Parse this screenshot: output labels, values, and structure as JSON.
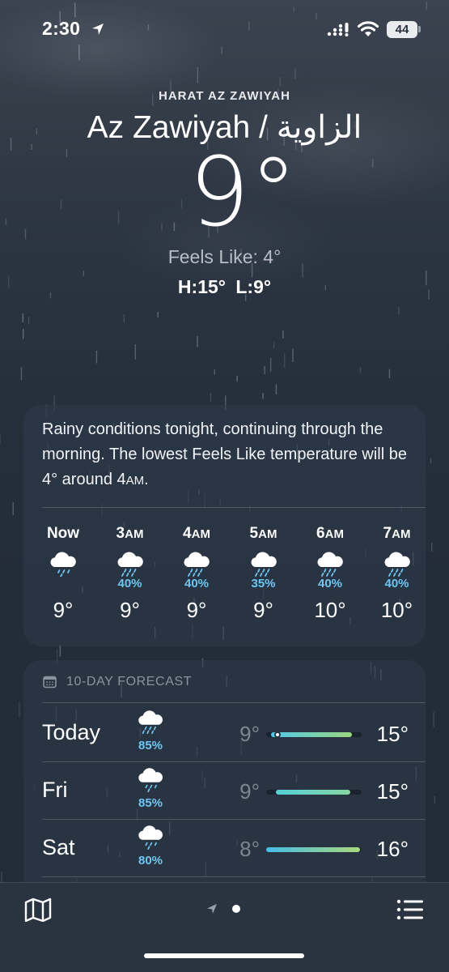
{
  "status_bar": {
    "time": "2:30",
    "battery": "44",
    "icons": [
      "location-arrow-icon",
      "cellular-signal-icon",
      "wifi-icon",
      "battery-icon"
    ]
  },
  "location": {
    "region": "HARAT AZ ZAWIYAH",
    "city": "Az Zawiyah / الزاوية",
    "temperature": "9°",
    "feels_like": "Feels Like: 4°",
    "high_low": "H:15°  L:9°"
  },
  "hourly_card": {
    "summary_part1": "Rainy conditions tonight, continuing through the morning. The lowest Feels Like temperature will be 4° around 4",
    "summary_part2": "AM",
    "summary_part3": ".",
    "hours": [
      {
        "label": "Now",
        "suffix": "",
        "icon": "cloud-drizzle-icon",
        "pct": "",
        "temp": "9°"
      },
      {
        "label": "3",
        "suffix": "AM",
        "icon": "cloud-rain-icon",
        "pct": "40%",
        "temp": "9°"
      },
      {
        "label": "4",
        "suffix": "AM",
        "icon": "cloud-rain-icon",
        "pct": "40%",
        "temp": "9°"
      },
      {
        "label": "5",
        "suffix": "AM",
        "icon": "cloud-rain-icon",
        "pct": "35%",
        "temp": "9°"
      },
      {
        "label": "6",
        "suffix": "AM",
        "icon": "cloud-rain-icon",
        "pct": "40%",
        "temp": "10°"
      },
      {
        "label": "7",
        "suffix": "AM",
        "icon": "cloud-rain-icon",
        "pct": "40%",
        "temp": "10°"
      }
    ]
  },
  "daily_card": {
    "header": "10-DAY FORECAST",
    "header_icon": "calendar-icon",
    "days": [
      {
        "name": "Today",
        "icon": "cloud-rain-icon",
        "pct": "85%",
        "low": "9°",
        "high": "15°",
        "bar_start": 0.05,
        "bar_end": 0.9,
        "bar_from": "#4fc9e8",
        "bar_to": "#9bd67f",
        "now_marker": 0.12
      },
      {
        "name": "Fri",
        "icon": "cloud-drizzle-icon",
        "pct": "85%",
        "low": "9°",
        "high": "15°",
        "bar_start": 0.1,
        "bar_end": 0.88,
        "bar_from": "#55d0d8",
        "bar_to": "#86d6a2"
      },
      {
        "name": "Sat",
        "icon": "cloud-drizzle-icon",
        "pct": "80%",
        "low": "8°",
        "high": "16°",
        "bar_start": 0.0,
        "bar_end": 0.98,
        "bar_from": "#45bde6",
        "bar_to": "#a8d87c"
      }
    ]
  },
  "bottom_bar": {
    "left_icon": "map-icon",
    "page_indicator": [
      "location-arrow-icon",
      "page-dot-icon"
    ],
    "right_icon": "list-icon"
  }
}
